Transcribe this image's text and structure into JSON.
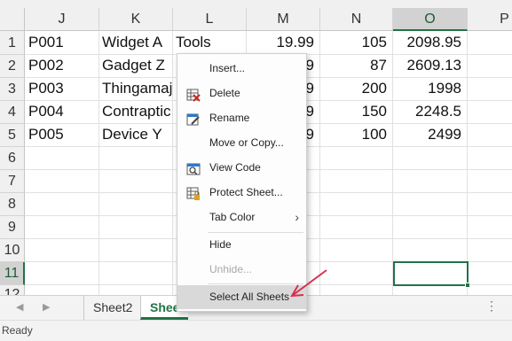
{
  "columns": [
    {
      "letter": "J",
      "selected": false
    },
    {
      "letter": "K",
      "selected": false
    },
    {
      "letter": "L",
      "selected": false
    },
    {
      "letter": "M",
      "selected": false
    },
    {
      "letter": "N",
      "selected": false
    },
    {
      "letter": "O",
      "selected": true
    },
    {
      "letter": "P",
      "selected": false
    }
  ],
  "rows": [
    "1",
    "2",
    "3",
    "4",
    "5",
    "6",
    "7",
    "8",
    "9",
    "10",
    "11",
    "12"
  ],
  "selected_row": "11",
  "data_rows": [
    {
      "id": "P001",
      "name": "Widget A",
      "category": "Tools",
      "price": "19.99",
      "qty": "105",
      "total": "2098.95"
    },
    {
      "id": "P002",
      "name": "Gadget Z",
      "category": "",
      "price": "9",
      "qty": "87",
      "total": "2609.13"
    },
    {
      "id": "P003",
      "name": "Thingamaj",
      "category": "",
      "price": "9",
      "qty": "200",
      "total": "1998"
    },
    {
      "id": "P004",
      "name": "Contraptic",
      "category": "",
      "price": "9",
      "qty": "150",
      "total": "2248.5"
    },
    {
      "id": "P005",
      "name": "Device Y",
      "category": "",
      "price": "9",
      "qty": "100",
      "total": "2499"
    }
  ],
  "sheet_tabs": [
    {
      "label": "Sheet2",
      "active": false
    },
    {
      "label": "Shee",
      "active": true
    }
  ],
  "status": {
    "text": "Ready"
  },
  "context_menu": {
    "items": [
      {
        "key": "insert",
        "label": "Insert...",
        "icon": "none",
        "disabled": false
      },
      {
        "key": "delete",
        "label": "Delete",
        "icon": "delete-sheet-icon",
        "disabled": false
      },
      {
        "key": "rename",
        "label": "Rename",
        "icon": "rename-icon",
        "disabled": false
      },
      {
        "key": "move_copy",
        "label": "Move or Copy...",
        "icon": "none",
        "disabled": false
      },
      {
        "key": "view_code",
        "label": "View Code",
        "icon": "view-code-icon",
        "disabled": false
      },
      {
        "key": "protect",
        "label": "Protect Sheet...",
        "icon": "protect-sheet-icon",
        "disabled": false
      },
      {
        "key": "tab_color",
        "label": "Tab Color",
        "icon": "none",
        "disabled": false,
        "submenu": true
      },
      {
        "key": "hide",
        "label": "Hide",
        "icon": "none",
        "disabled": false
      },
      {
        "key": "unhide",
        "label": "Unhide...",
        "icon": "none",
        "disabled": true
      },
      {
        "key": "select_all",
        "label": "Select All Sheets",
        "icon": "none",
        "disabled": false,
        "hovered": true
      }
    ]
  },
  "colors": {
    "accent": "#217346",
    "arrow": "#d6304f"
  }
}
